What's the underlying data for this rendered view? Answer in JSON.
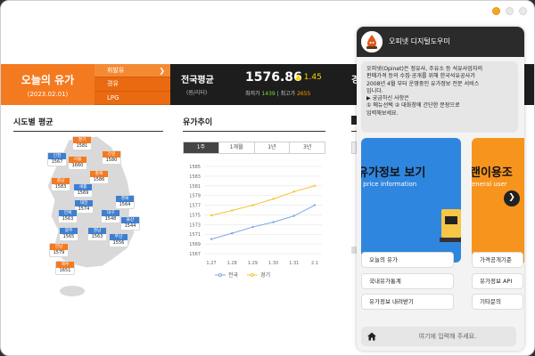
{
  "banner": {
    "title": "오늘의 유가",
    "date": "(2023.02.01)",
    "tabs": [
      "휘발유",
      "경유",
      "LPG"
    ],
    "avg_label": "전국평균",
    "unit": "(원/리터)",
    "price": "1576.86",
    "change": "▲ 1.45",
    "min_label": "최저가",
    "min_value": "1439",
    "max_label": "최고가",
    "max_value": "2655",
    "third_initial": "경"
  },
  "sections": {
    "regional_title": "시도별 평균",
    "trend_title": "유가추이"
  },
  "map": {
    "regions": [
      {
        "name": "경기",
        "value": "1581",
        "color": "orange"
      },
      {
        "name": "인천",
        "value": "1567",
        "color": "blue"
      },
      {
        "name": "서울",
        "value": "1660",
        "color": "orange"
      },
      {
        "name": "강원",
        "value": "1580",
        "color": "orange"
      },
      {
        "name": "충북",
        "value": "1586",
        "color": "orange"
      },
      {
        "name": "충남",
        "value": "1583",
        "color": "orange"
      },
      {
        "name": "세종",
        "value": "1569",
        "color": "blue"
      },
      {
        "name": "경북",
        "value": "1564",
        "color": "blue"
      },
      {
        "name": "대전",
        "value": "1574",
        "color": "blue"
      },
      {
        "name": "전북",
        "value": "1563",
        "color": "blue"
      },
      {
        "name": "대구",
        "value": "1548",
        "color": "blue"
      },
      {
        "name": "울산",
        "value": "1544",
        "color": "blue"
      },
      {
        "name": "광주",
        "value": "1565",
        "color": "blue"
      },
      {
        "name": "경남",
        "value": "1563",
        "color": "blue"
      },
      {
        "name": "부산",
        "value": "1556",
        "color": "blue"
      },
      {
        "name": "전남",
        "value": "1579",
        "color": "orange"
      },
      {
        "name": "제주",
        "value": "1651",
        "color": "orange"
      }
    ]
  },
  "trend": {
    "range_tabs": [
      "1주",
      "1개월",
      "1년",
      "3년"
    ],
    "active_tab": "1주"
  },
  "chart_data": {
    "type": "line",
    "x": [
      "1.27",
      "1.28",
      "1.29",
      "1.30",
      "1.31",
      "2.1"
    ],
    "ylim": [
      1567,
      1585
    ],
    "yticks": [
      "1585",
      "1583",
      "1581",
      "1579",
      "1577",
      "1575",
      "1573",
      "1571",
      "1569",
      "1567"
    ],
    "series": [
      {
        "name": "전국",
        "values": [
          1570.0,
          1571.2,
          1572.5,
          1573.5,
          1574.8,
          1577.0
        ],
        "color": "#7da6e6"
      },
      {
        "name": "경기",
        "values": [
          1574.9,
          1575.9,
          1577.0,
          1578.3,
          1579.8,
          1581.0
        ],
        "color": "#f5c42b"
      }
    ]
  },
  "chat": {
    "title": "오피넷 디지털도우미",
    "message": "오피넷(Opinet)은 정유사, 주유소 등 석유사업자의\n판매가격 등의 수집·공개를 위해 한국석유공사가\n2008년 4월 부터 운영중인 유가정보 전문 서비스\n입니다.\n▶ 궁금하신 사항은\n① 메뉴선택 ② 대화창에 간단한 문장으로\n입력해보세요.",
    "card1_title": "유가정보 보기",
    "card1_sub": "l price information",
    "card2_title": "랜이용조",
    "card2_sub": "eneral user",
    "buttons": [
      "오늘의 유가",
      "국내유가통계",
      "유가정보 내려받기"
    ],
    "buttons2": [
      "가격공개기준",
      "유가정보 API",
      "기타문의"
    ],
    "input_placeholder": "여기에 입력해 주세요."
  }
}
